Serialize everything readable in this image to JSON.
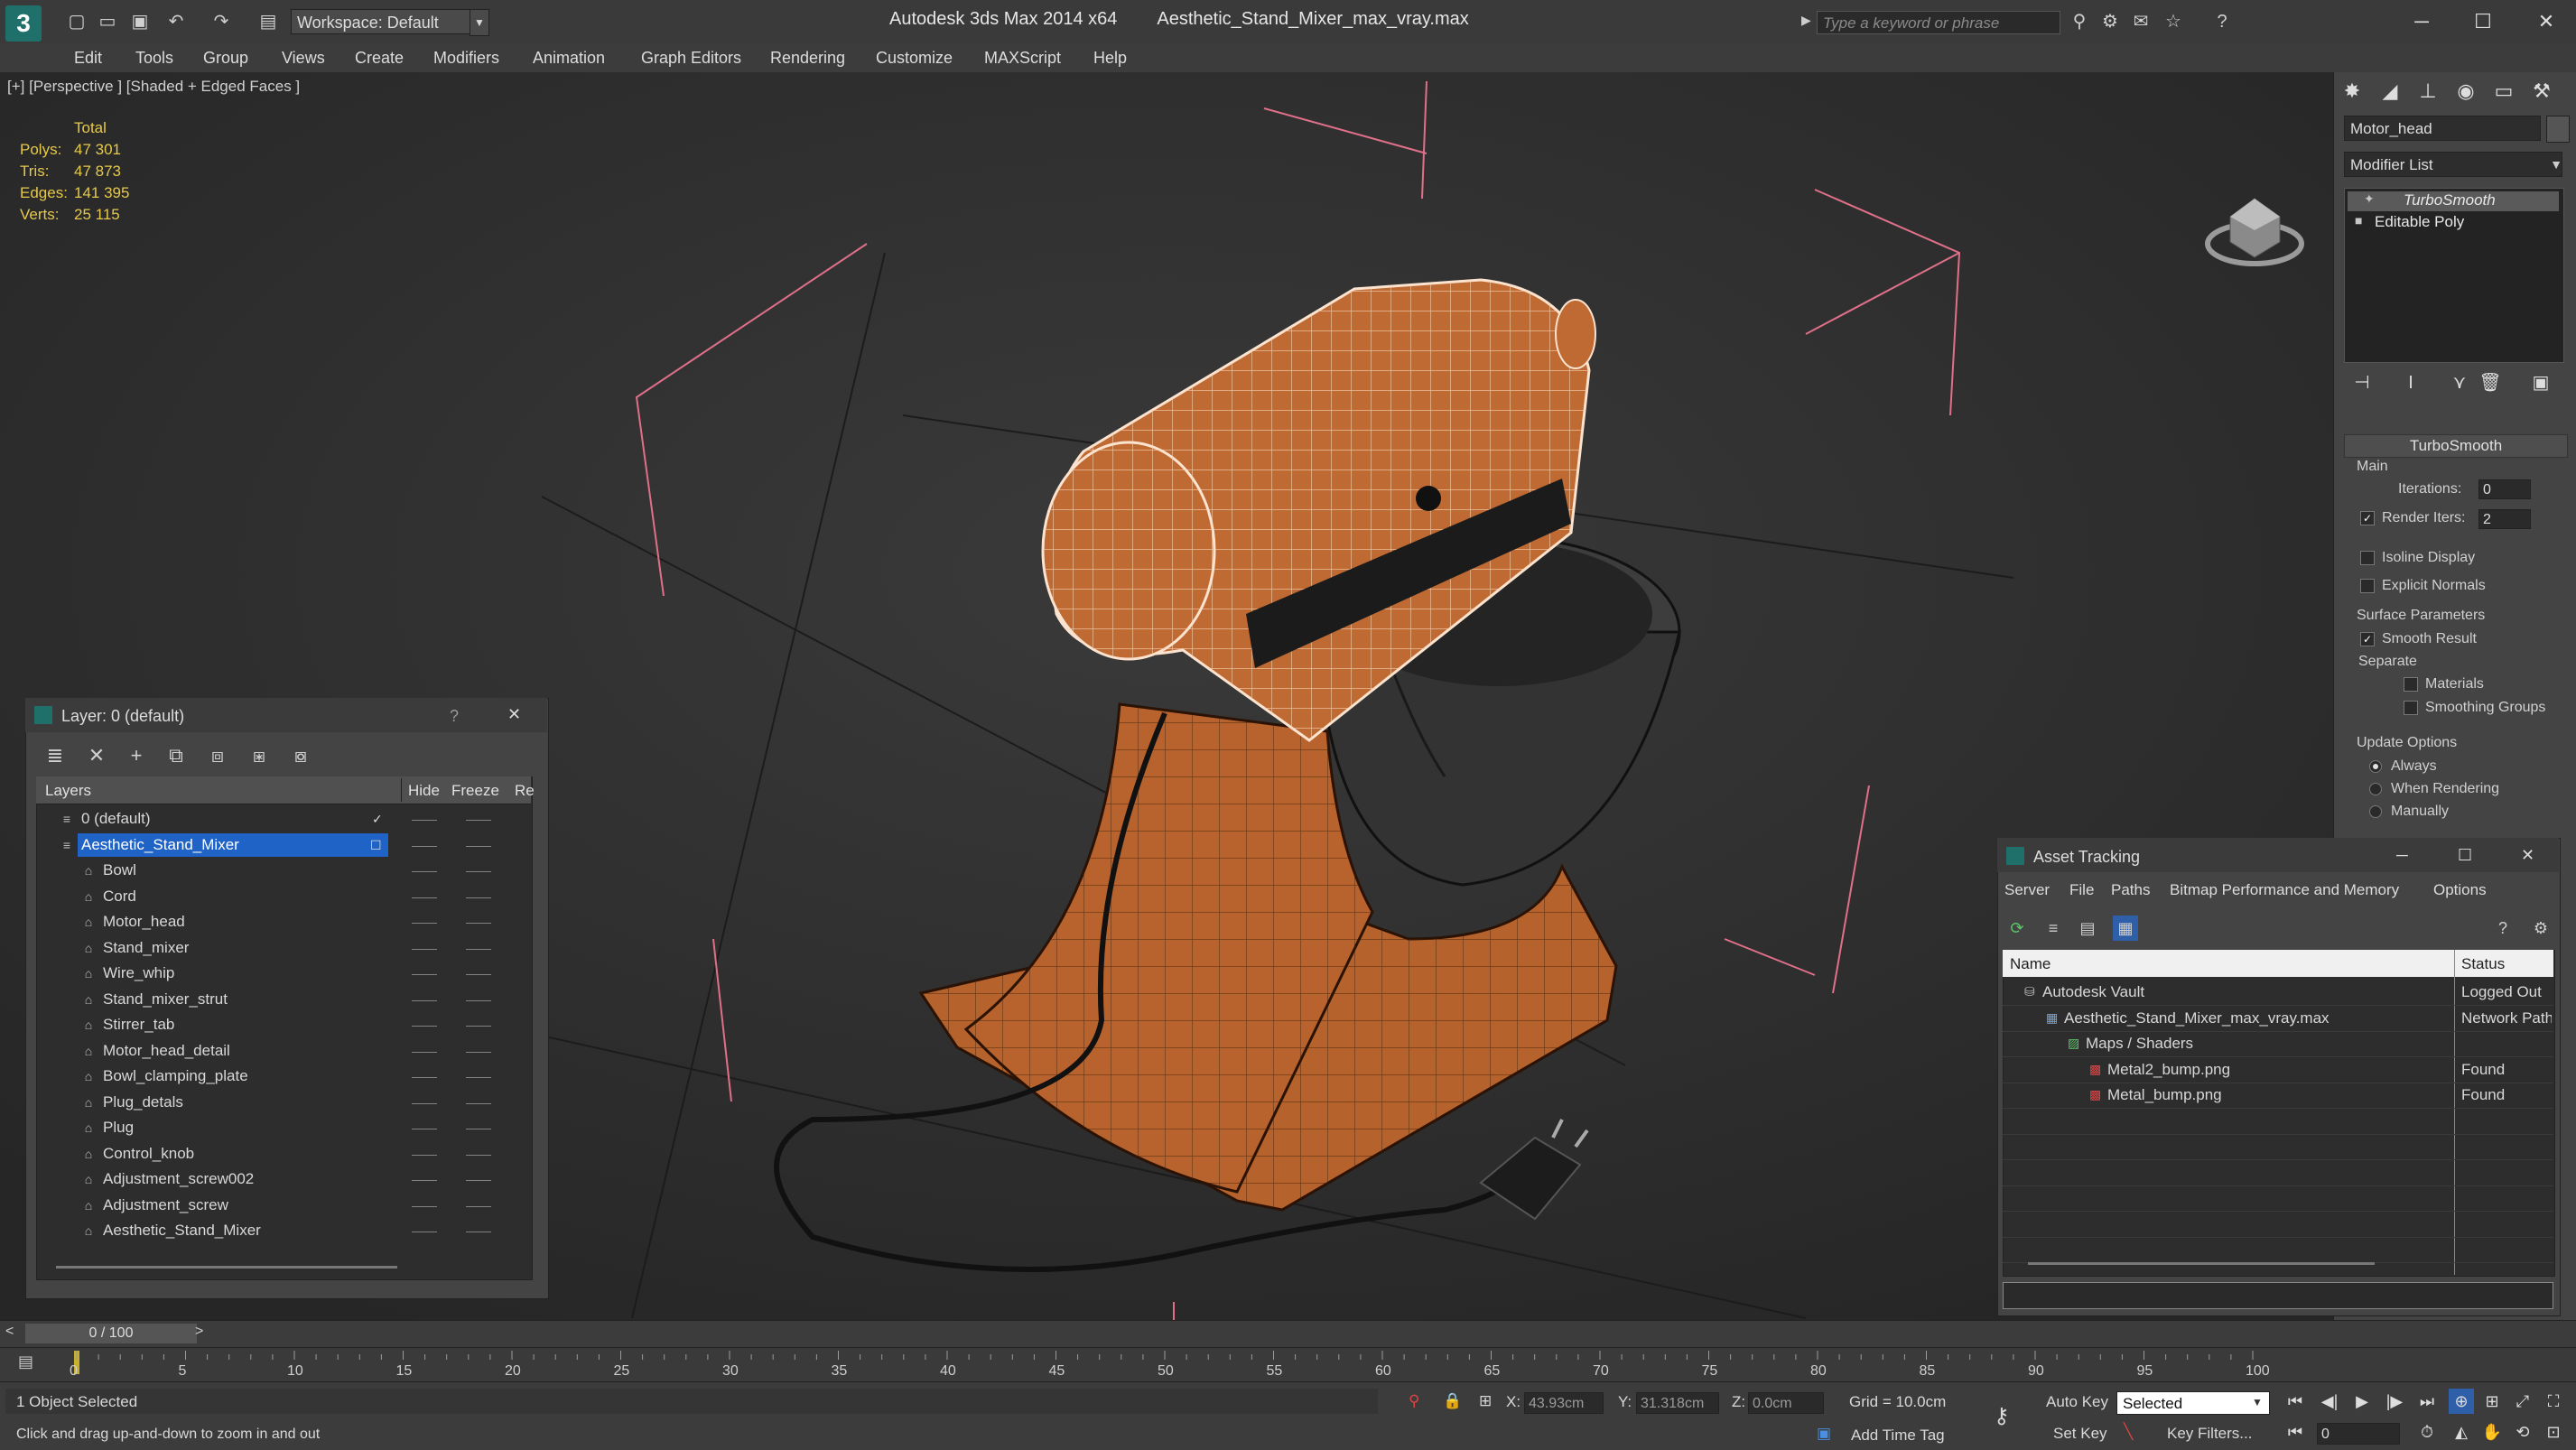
{
  "app": {
    "title_product": "Autodesk 3ds Max  2014 x64",
    "title_file": "Aesthetic_Stand_Mixer_max_vray.max",
    "workspace": "Workspace: Default",
    "search_placeholder": "Type a keyword or phrase",
    "logo": "3"
  },
  "menu": [
    "Edit",
    "Tools",
    "Group",
    "Views",
    "Create",
    "Modifiers",
    "Animation",
    "Graph Editors",
    "Rendering",
    "Customize",
    "MAXScript",
    "Help"
  ],
  "viewport": {
    "label": "[+] [Perspective ] [Shaded + Edged Faces ]",
    "stats_total": "Total",
    "stats": [
      {
        "key": "Polys:",
        "val": "47 301"
      },
      {
        "key": "Tris:",
        "val": "47 873"
      },
      {
        "key": "Edges:",
        "val": "141 395"
      },
      {
        "key": "Verts:",
        "val": "25 115"
      }
    ]
  },
  "command_panel": {
    "object_name": "Motor_head",
    "modifier_list": "Modifier List",
    "stack": [
      "TurboSmooth",
      "Editable Poly"
    ],
    "rollout_title": "TurboSmooth",
    "main_label": "Main",
    "iterations_label": "Iterations:",
    "iterations_value": "0",
    "render_iters_label": "Render Iters:",
    "render_iters_value": "2",
    "isoline": "Isoline Display",
    "explicit_normals": "Explicit Normals",
    "surface_params": "Surface Parameters",
    "smooth_result": "Smooth Result",
    "separate": "Separate",
    "materials": "Materials",
    "smoothing_groups": "Smoothing Groups",
    "update_options": "Update Options",
    "always": "Always",
    "when_rendering": "When Rendering",
    "manually": "Manually"
  },
  "layer_dialog": {
    "title": "Layer: 0 (default)",
    "help": "?",
    "close": "✕",
    "col_layers": "Layers",
    "col_hide": "Hide",
    "col_freeze": "Freeze",
    "col_render": "Re",
    "rows": [
      {
        "name": "0 (default)",
        "indent": 0,
        "type": "layer"
      },
      {
        "name": "Aesthetic_Stand_Mixer",
        "indent": 0,
        "type": "layer",
        "selected": true
      },
      {
        "name": "Bowl",
        "indent": 1,
        "type": "obj"
      },
      {
        "name": "Cord",
        "indent": 1,
        "type": "obj"
      },
      {
        "name": "Motor_head",
        "indent": 1,
        "type": "obj"
      },
      {
        "name": "Stand_mixer",
        "indent": 1,
        "type": "obj"
      },
      {
        "name": "Wire_whip",
        "indent": 1,
        "type": "obj"
      },
      {
        "name": "Stand_mixer_strut",
        "indent": 1,
        "type": "obj"
      },
      {
        "name": "Stirrer_tab",
        "indent": 1,
        "type": "obj"
      },
      {
        "name": "Motor_head_detail",
        "indent": 1,
        "type": "obj"
      },
      {
        "name": "Bowl_clamping_plate",
        "indent": 1,
        "type": "obj"
      },
      {
        "name": "Plug_detals",
        "indent": 1,
        "type": "obj"
      },
      {
        "name": "Plug",
        "indent": 1,
        "type": "obj"
      },
      {
        "name": "Control_knob",
        "indent": 1,
        "type": "obj"
      },
      {
        "name": "Adjustment_screw002",
        "indent": 1,
        "type": "obj"
      },
      {
        "name": "Adjustment_screw",
        "indent": 1,
        "type": "obj"
      },
      {
        "name": "Aesthetic_Stand_Mixer",
        "indent": 1,
        "type": "obj"
      }
    ]
  },
  "asset_tracking": {
    "title": "Asset Tracking",
    "menu": [
      "Server",
      "File",
      "Paths",
      "Bitmap Performance and Memory",
      "Options"
    ],
    "col_name": "Name",
    "col_status": "Status",
    "rows": [
      {
        "name": "Autodesk Vault",
        "status": "Logged Out",
        "indent": 1
      },
      {
        "name": "Aesthetic_Stand_Mixer_max_vray.max",
        "status": "Network Path",
        "indent": 2
      },
      {
        "name": "Maps / Shaders",
        "status": "",
        "indent": 3
      },
      {
        "name": "Metal2_bump.png",
        "status": "Found",
        "indent": 4
      },
      {
        "name": "Metal_bump.png",
        "status": "Found",
        "indent": 4
      }
    ]
  },
  "timeline": {
    "frame_counter": "0 / 100",
    "ticks": [
      "0",
      "5",
      "10",
      "15",
      "20",
      "25",
      "30",
      "35",
      "40",
      "45",
      "50",
      "55",
      "60",
      "65",
      "70",
      "75",
      "80",
      "85",
      "90",
      "95",
      "100"
    ]
  },
  "status": {
    "selected_count": "1 Object Selected",
    "prompt": "Click and drag up-and-down to zoom in and out",
    "x_label": "X:",
    "x_value": "43.93cm",
    "y_label": "Y:",
    "y_value": "31.318cm",
    "z_label": "Z:",
    "z_value": "0.0cm",
    "grid": "Grid = 10.0cm",
    "add_time_tag": "Add Time Tag",
    "auto_key": "Auto Key",
    "set_key": "Set Key",
    "selected_dropdown": "Selected",
    "key_filters": "Key Filters...",
    "frame_field": "0"
  },
  "colors": {
    "accent_selection": "#1f63c6",
    "mixer_body": "#b8632e",
    "wire": "#f3c7a3",
    "stats": "#e6c94b"
  }
}
